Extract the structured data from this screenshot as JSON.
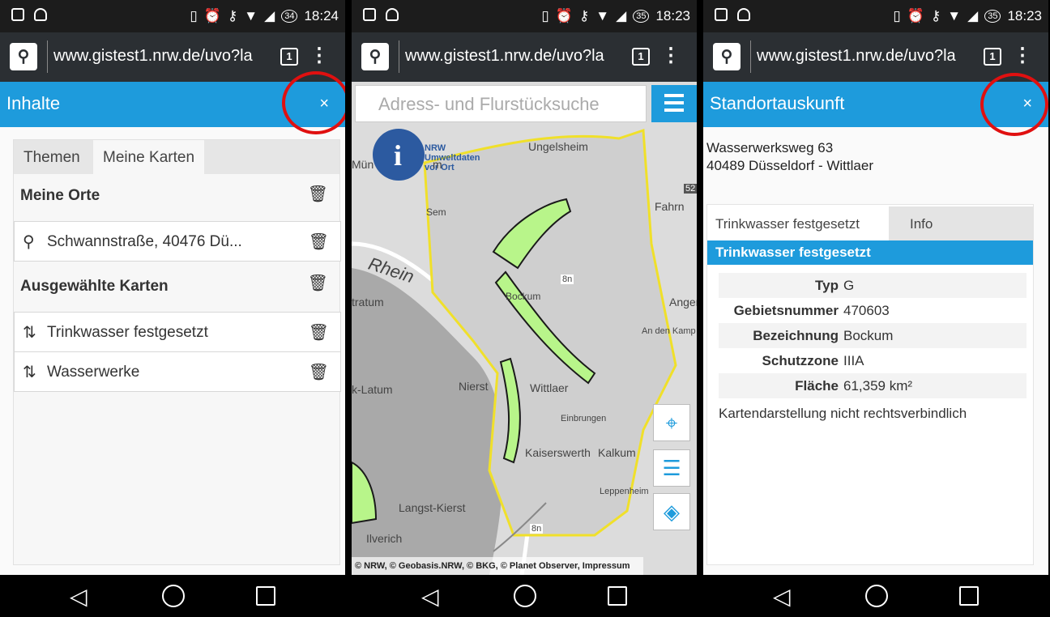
{
  "status": [
    {
      "time": "18:24",
      "battery": "34"
    },
    {
      "time": "18:23",
      "battery": "35"
    },
    {
      "time": "18:23",
      "battery": "35"
    }
  ],
  "browser": {
    "url": "www.gistest1.nrw.de/uvo?la",
    "tab_count": "1"
  },
  "panel1": {
    "title": "Inhalte",
    "close": "×",
    "tabs": [
      "Themen",
      "Meine Karten"
    ],
    "section_places": "Meine Orte",
    "places": [
      "Schwannstraße, 40476 Dü..."
    ],
    "section_maps": "Ausgewählte Karten",
    "maps": [
      "Trinkwasser festgesetzt",
      "Wasserwerke"
    ]
  },
  "panel2": {
    "search_placeholder": "Adress- und Flurstücksuche",
    "logo_text": [
      "NRW",
      "Umweltdaten",
      "vor Ort"
    ],
    "labels": [
      "Ungelsheim",
      "Rhein",
      "Nierst",
      "Wittlaer",
      "Einbrungen",
      "Kaiserswerth",
      "Kalkum",
      "Langst-Kierst",
      "Ilverich",
      "Angermund",
      "Fahrn",
      "An den Kamp",
      "Leppenheim",
      "Sem",
      "Bockum",
      "8n",
      "8n",
      "52",
      "k-Latum",
      "tratum",
      "Mün",
      "m"
    ],
    "attribution": "© NRW, © Geobasis.NRW, © BKG, © Planet Observer, Impressum"
  },
  "panel3": {
    "title": "Standortauskunft",
    "close": "×",
    "address_line1": "Wasserwerksweg 63",
    "address_line2": "40489 Düsseldorf - Wittlaer",
    "tabs": [
      "Trinkwasser festgesetzt",
      "Info"
    ],
    "section": "Trinkwasser festgesetzt",
    "rows": [
      {
        "key": "Typ",
        "value": "G"
      },
      {
        "key": "Gebietsnummer",
        "value": "470603"
      },
      {
        "key": "Bezeichnung",
        "value": "Bockum"
      },
      {
        "key": "Schutzzone",
        "value": "IIIA"
      },
      {
        "key": "Fläche",
        "value": "61,359 km²"
      }
    ],
    "note": "Kartendarstellung nicht rechtsverbindlich"
  },
  "colors": {
    "accent": "#1e9bdc",
    "highlight": "#e01010"
  }
}
